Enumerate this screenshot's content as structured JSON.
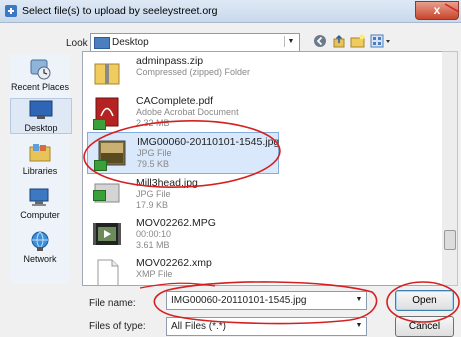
{
  "window": {
    "title": "Select file(s) to upload by seeleystreet.org",
    "close_label": "x"
  },
  "lookin": {
    "label": "Look in:",
    "value": "Desktop"
  },
  "toolbar": {
    "icons": [
      "back-icon",
      "up-folder-icon",
      "new-folder-icon",
      "views-icon"
    ]
  },
  "places": [
    {
      "label": "Recent Places",
      "icon": "recent-places-icon"
    },
    {
      "label": "Desktop",
      "icon": "desktop-icon"
    },
    {
      "label": "Libraries",
      "icon": "libraries-icon"
    },
    {
      "label": "Computer",
      "icon": "computer-icon"
    },
    {
      "label": "Network",
      "icon": "network-icon"
    }
  ],
  "files": [
    {
      "name": "adminpass.zip",
      "type": "Compressed (zipped) Folder",
      "size": ""
    },
    {
      "name": "CAComplete.pdf",
      "type": "Adobe Acrobat Document",
      "size": "2.32 MB"
    },
    {
      "name": "IMG00060-20110101-1545.jpg",
      "type": "JPG File",
      "size": "79.5 KB"
    },
    {
      "name": "Mill3head.jpg",
      "type": "JPG File",
      "size": "17.9 KB"
    },
    {
      "name": "MOV02262.MPG",
      "type": "00:00:10",
      "size": "3.61 MB"
    },
    {
      "name": "MOV02262.xmp",
      "type": "XMP File",
      "size": ""
    }
  ],
  "filename": {
    "label": "File name:",
    "value": "IMG00060-20110101-1545.jpg"
  },
  "filetype": {
    "label": "Files of type:",
    "value": "All Files (*.*)"
  },
  "buttons": {
    "open": "Open",
    "cancel": "Cancel"
  },
  "colors": {
    "annotation": "#d42020",
    "selection": "#d9e8fb"
  }
}
